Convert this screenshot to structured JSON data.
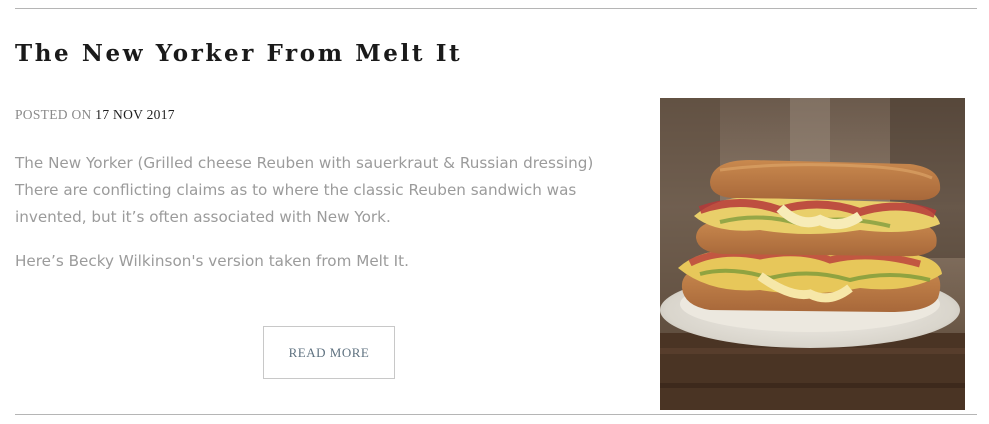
{
  "post": {
    "title": "The New Yorker From Melt It",
    "posted_label": "POSTED ON",
    "posted_date": "17 NOV 2017",
    "paragraphs": [
      "The New Yorker (Grilled cheese Reuben with sauerkraut & Russian dressing) There are conflicting claims as to where the classic Reuben sandwich was invented, but it’s often associated with New York.",
      "Here’s Becky Wilkinson's version taken from Melt It."
    ],
    "read_more_label": "READ MORE",
    "image_subject": "grilled-cheese-reuben-sandwich-photo"
  },
  "colors": {
    "title": "#1a1a1a",
    "meta_label": "#8a8a8a",
    "body_text": "#9b9b9b",
    "button_text": "#5f7280",
    "divider": "#b5b5b5"
  }
}
